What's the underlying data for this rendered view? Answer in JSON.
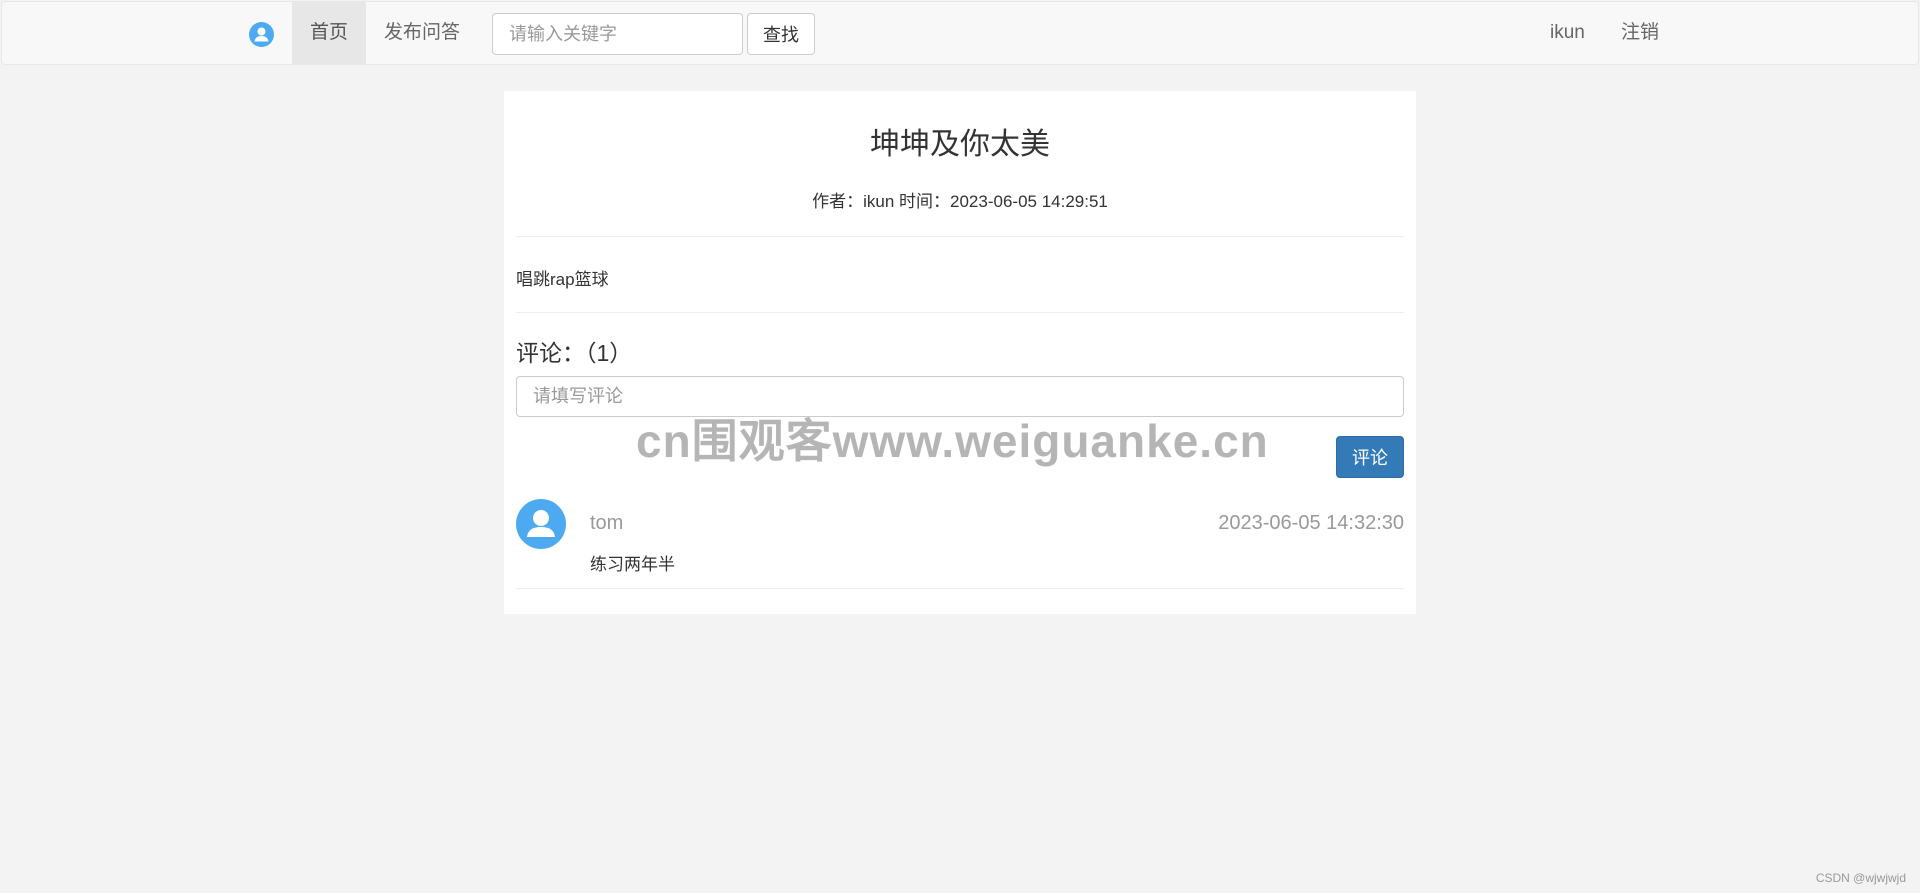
{
  "nav": {
    "logo_icon": "user-icon",
    "items": [
      {
        "label": "首页",
        "active": true
      },
      {
        "label": "发布问答",
        "active": false
      }
    ],
    "search": {
      "placeholder": "请输入关键字",
      "value": "",
      "button_label": "查找"
    },
    "user": {
      "name": "ikun",
      "logout_label": "注销"
    }
  },
  "post": {
    "title": "坤坤及你太美",
    "meta": "作者：ikun 时间：2023-06-05 14:29:51",
    "content": "唱跳rap篮球"
  },
  "comments": {
    "heading": "评论：（1）",
    "input_placeholder": "请填写评论",
    "input_value": "",
    "submit_label": "评论",
    "items": [
      {
        "avatar_icon": "user-icon",
        "author": "tom",
        "time": "2023-06-05 14:32:30",
        "text": "练习两年半"
      }
    ]
  },
  "watermark": "cn围观客www.weiguanke.cn",
  "credit": "CSDN @wjwjwjd",
  "colors": {
    "accent": "#337ab7",
    "avatar": "#4eaaf0",
    "background": "#f3f3f3",
    "navbar": "#f8f8f8"
  }
}
